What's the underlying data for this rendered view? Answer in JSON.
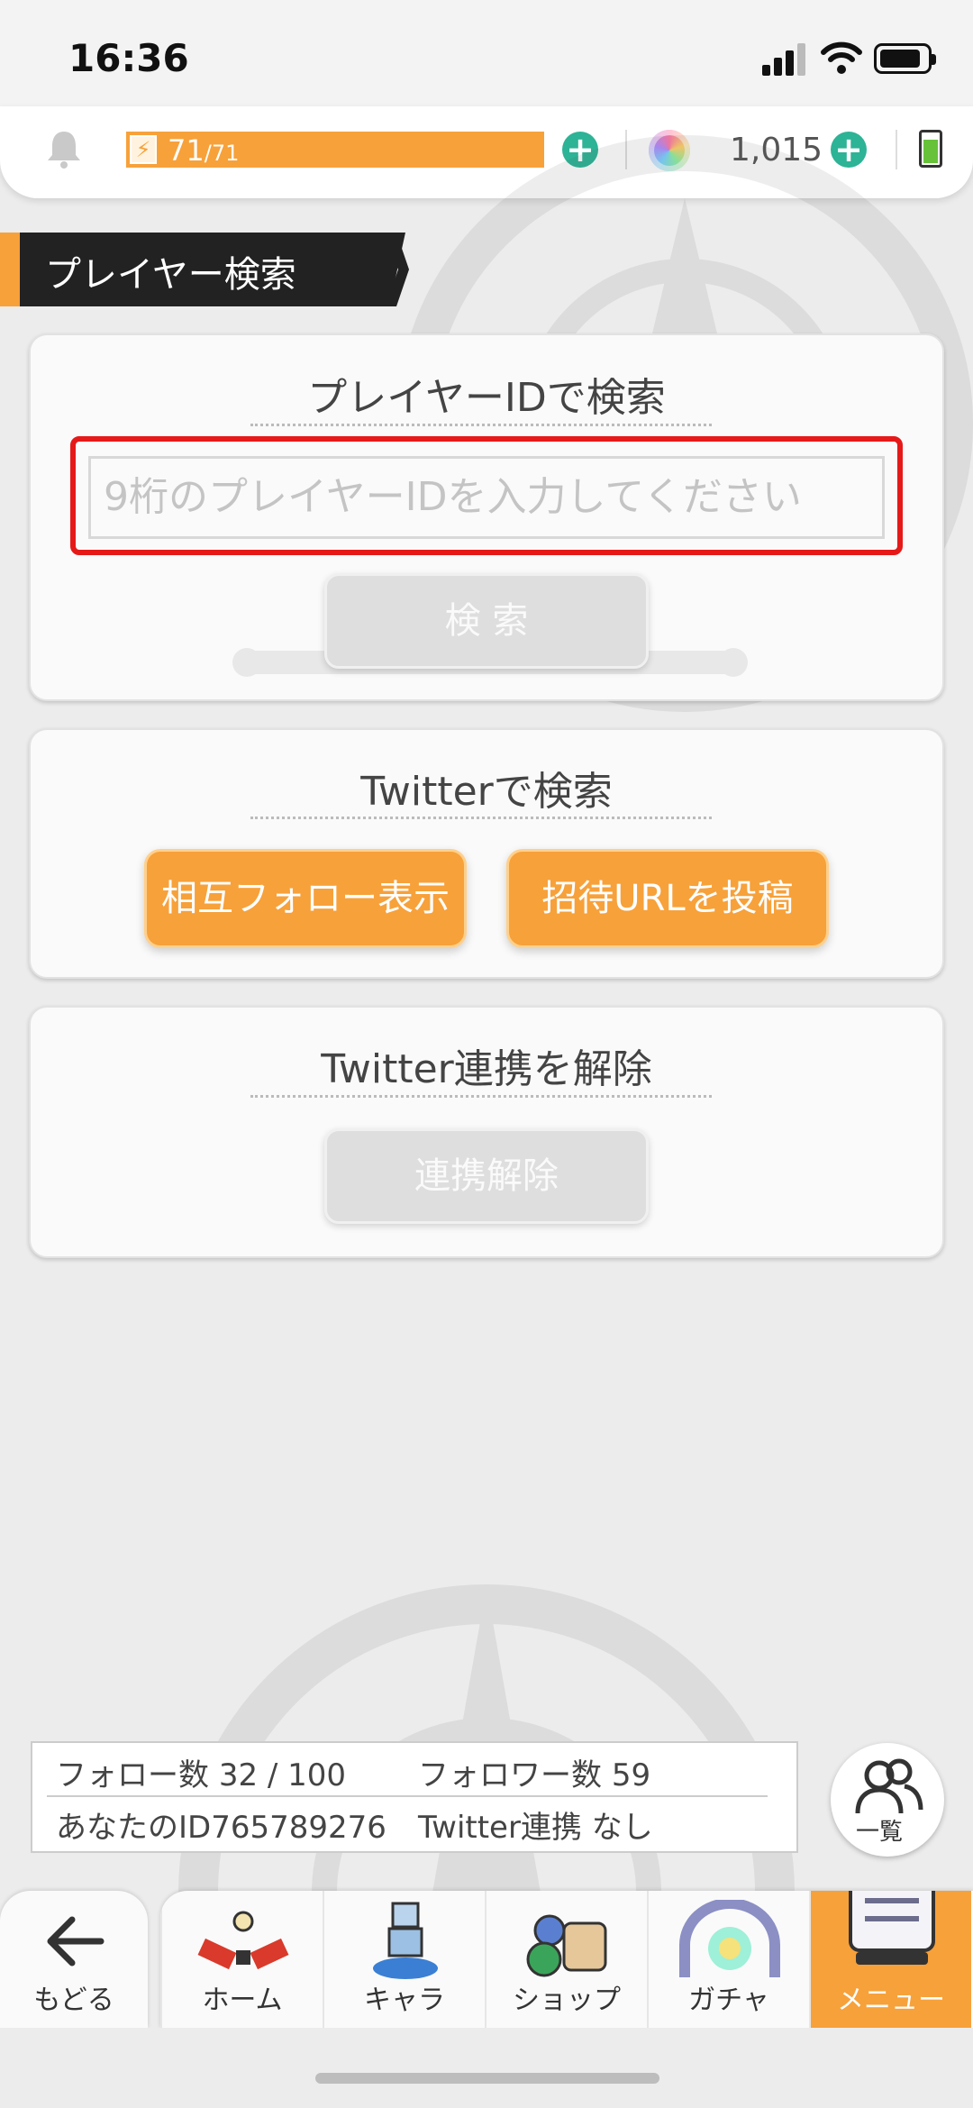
{
  "status_bar": {
    "time": "16:36"
  },
  "top_bar": {
    "stamina_current": "71",
    "stamina_max": "71",
    "stamina_fraction": 1.0,
    "gems": "1,015"
  },
  "section": {
    "title": "プレイヤー検索"
  },
  "id_search": {
    "title": "プレイヤーIDで検索",
    "placeholder": "9桁のプレイヤーIDを入力してください",
    "search_label": "検 索"
  },
  "twitter_search": {
    "title": "Twitterで検索",
    "mutual_label": "相互フォロー表示",
    "post_label": "招待URLを投稿"
  },
  "twitter_unlink": {
    "title": "Twitter連携を解除",
    "unlink_label": "連携解除"
  },
  "info": {
    "follow_label": "フォロー数",
    "follow_value": "32 / 100",
    "follower_label": "フォロワー数",
    "follower_value": "59",
    "id_label": "あなたのID",
    "id_value": "765789276",
    "twitter_label": "Twitter連携",
    "twitter_value": "なし"
  },
  "list_button": {
    "label": "一覧"
  },
  "nav": {
    "back": "もどる",
    "tabs": [
      {
        "label": "ホーム"
      },
      {
        "label": "キャラ"
      },
      {
        "label": "ショップ"
      },
      {
        "label": "ガチャ"
      },
      {
        "label": "メニュー"
      }
    ]
  },
  "colors": {
    "accent_orange": "#f7a13a",
    "plus_green": "#2db396",
    "highlight_red": "#e61919"
  }
}
